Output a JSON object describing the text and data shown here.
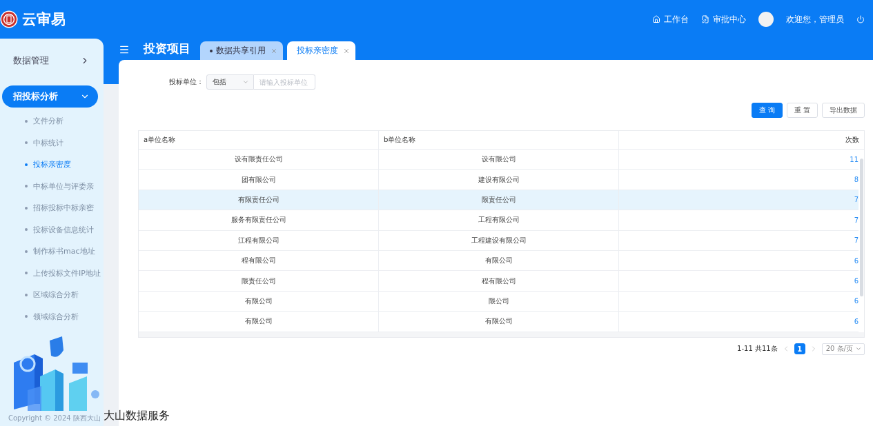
{
  "app": {
    "title": "云审易"
  },
  "header_nav": [
    {
      "label": "工作台",
      "kind": "home"
    },
    {
      "label": "审批中心",
      "kind": "approval"
    }
  ],
  "user": {
    "greeting": "欢迎您，管理员"
  },
  "sidebar": {
    "items": [
      {
        "label": "数据管理",
        "expanded": false,
        "selected": false
      },
      {
        "label": "招投标分析",
        "expanded": true,
        "selected": true,
        "children": [
          {
            "label": "文件分析",
            "selected": false
          },
          {
            "label": "中标统计",
            "selected": false
          },
          {
            "label": "投标亲密度",
            "selected": true
          },
          {
            "label": "中标单位与评委亲",
            "selected": false
          },
          {
            "label": "招标投标中标亲密",
            "selected": false
          },
          {
            "label": "投标设备信息统计",
            "selected": false
          },
          {
            "label": "制作标书mac地址",
            "selected": false
          },
          {
            "label": "上传投标文件IP地址",
            "selected": false
          },
          {
            "label": "区域综合分析",
            "selected": false
          },
          {
            "label": "领域综合分析",
            "selected": false
          }
        ]
      }
    ]
  },
  "page_title": "投资项目",
  "tabs": [
    {
      "label": "数据共享引用",
      "selected": false
    },
    {
      "label": "投标亲密度",
      "selected": true
    }
  ],
  "filter": {
    "label": "投标单位：",
    "mode": "包括",
    "placeholder": "请输入投标单位"
  },
  "buttons": [
    {
      "label": "查 询",
      "kind": "primary"
    },
    {
      "label": "重 置",
      "kind": "default"
    },
    {
      "label": "导出数据",
      "kind": "default"
    }
  ],
  "table": {
    "columns": [
      "a单位名称",
      "b单位名称",
      "次数"
    ],
    "rows": [
      {
        "a": "设有限责任公司",
        "b": "设有限公司",
        "count": "11",
        "selected": false
      },
      {
        "a": "团有限公司",
        "b": "建设有限公司",
        "count": "8",
        "selected": false
      },
      {
        "a": "有限责任公司",
        "b": "限责任公司",
        "count": "7",
        "selected": true
      },
      {
        "a": "服务有限责任公司",
        "b": "工程有限公司",
        "count": "7",
        "selected": false
      },
      {
        "a": "江程有限公司",
        "b": "工程建设有限公司",
        "count": "7",
        "selected": false
      },
      {
        "a": "程有限公司",
        "b": "有限公司",
        "count": "6",
        "selected": false
      },
      {
        "a": "限责任公司",
        "b": "程有限公司",
        "count": "6",
        "selected": false
      },
      {
        "a": "有限公司",
        "b": "限公司",
        "count": "6",
        "selected": false
      },
      {
        "a": "有限公司",
        "b": "有限公司",
        "count": "6",
        "selected": false
      }
    ]
  },
  "pagination": {
    "summary": "1-11 共11条",
    "pages": [
      {
        "label": "1",
        "selected": true
      }
    ],
    "page_size": "20 条/页"
  },
  "footer": {
    "copyright": "Copyright © 2024 陕西大山",
    "company": "大山数据服务"
  }
}
